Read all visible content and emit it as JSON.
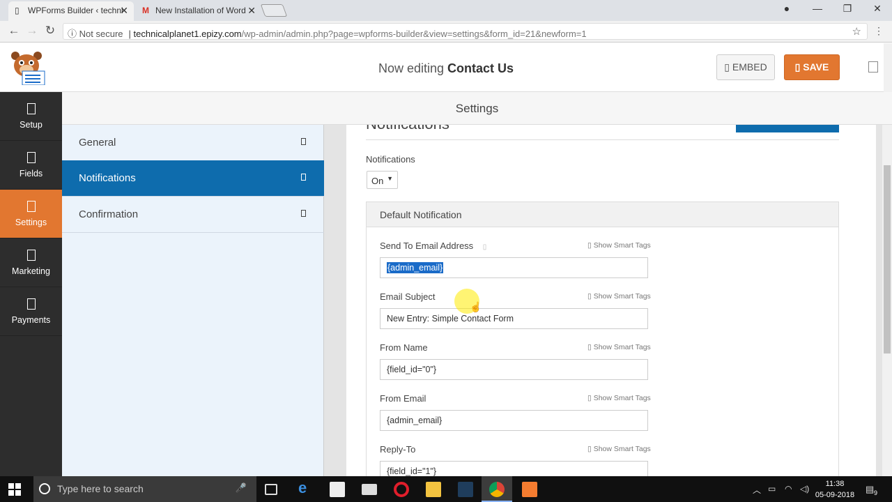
{
  "browser": {
    "tabs": [
      {
        "title": "WPForms Builder ‹ techni",
        "icon": "page-icon"
      },
      {
        "title": "New Installation of Word",
        "icon": "gmail-icon"
      }
    ],
    "not_secure": "Not secure",
    "url_host": "technicalplanet1.epizy.com",
    "url_path": "/wp-admin/admin.php?page=wpforms-builder&view=settings&form_id=21&newform=1"
  },
  "header": {
    "editing_prefix": "Now editing",
    "form_name": "Contact Us",
    "embed_label": "EMBED",
    "save_label": "SAVE"
  },
  "leftnav": {
    "items": [
      {
        "label": "Setup",
        "icon": "setup-icon"
      },
      {
        "label": "Fields",
        "icon": "fields-icon"
      },
      {
        "label": "Settings",
        "icon": "settings-icon"
      },
      {
        "label": "Marketing",
        "icon": "marketing-icon"
      },
      {
        "label": "Payments",
        "icon": "payments-icon"
      }
    ]
  },
  "settings_title": "Settings",
  "subnav": {
    "items": [
      {
        "label": "General"
      },
      {
        "label": "Notifications"
      },
      {
        "label": "Confirmation"
      }
    ]
  },
  "panel": {
    "title": "Notifications",
    "notifications_label": "Notifications",
    "notifications_value": "On",
    "box_title": "Default Notification",
    "smart_tags": "Show Smart Tags",
    "fields": [
      {
        "label": "Send To Email Address",
        "value": "{admin_email}"
      },
      {
        "label": "Email Subject",
        "value": "New Entry: Simple Contact Form"
      },
      {
        "label": "From Name",
        "value": "{field_id=\"0\"}"
      },
      {
        "label": "From Email",
        "value": "{admin_email}"
      },
      {
        "label": "Reply-To",
        "value": "{field_id=\"1\"}"
      }
    ]
  },
  "taskbar": {
    "search_placeholder": "Type here to search",
    "time": "11:38",
    "date": "05-09-2018",
    "notifications_count": "9"
  },
  "colors": {
    "accent": "#e27730",
    "blue": "#0e6cad",
    "dark_nav": "#2d2d2d"
  }
}
